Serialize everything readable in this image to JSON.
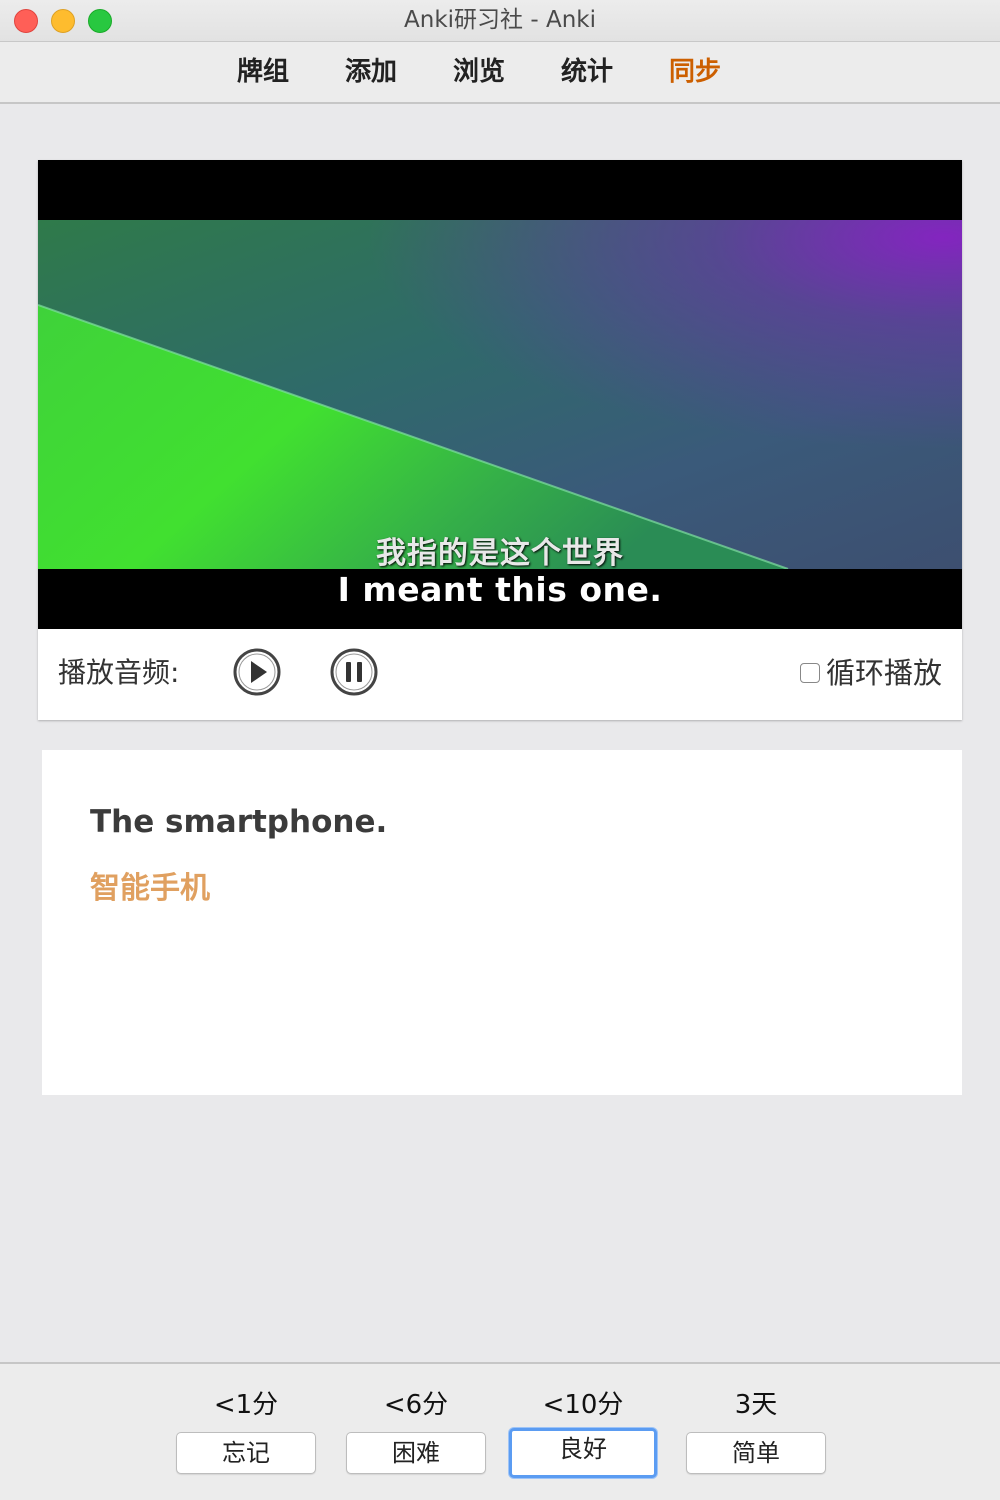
{
  "window": {
    "title": "Anki研习社 - Anki"
  },
  "toolbar": {
    "items": [
      {
        "label": "牌组"
      },
      {
        "label": "添加"
      },
      {
        "label": "浏览"
      },
      {
        "label": "统计"
      },
      {
        "label": "同步"
      }
    ],
    "active_color": "#cc5f00"
  },
  "media": {
    "subtitle_cn": "我指的是这个世界",
    "subtitle_en": "I meant this one.",
    "audio_label": "播放音频:",
    "play_icon": "play-circle-icon",
    "pause_icon": "pause-circle-icon",
    "loop_label": "循环播放",
    "loop_checked": false
  },
  "card": {
    "english": "The smartphone.",
    "chinese": "智能手机",
    "chinese_color": "#e0a060"
  },
  "answers": [
    {
      "interval": "<1分",
      "label": "忘记"
    },
    {
      "interval": "<6分",
      "label": "困难"
    },
    {
      "interval": "<10分",
      "label": "良好",
      "focused": true
    },
    {
      "interval": "3天",
      "label": "简单"
    }
  ],
  "colors": {
    "focus_ring": "#5b9cf2"
  }
}
